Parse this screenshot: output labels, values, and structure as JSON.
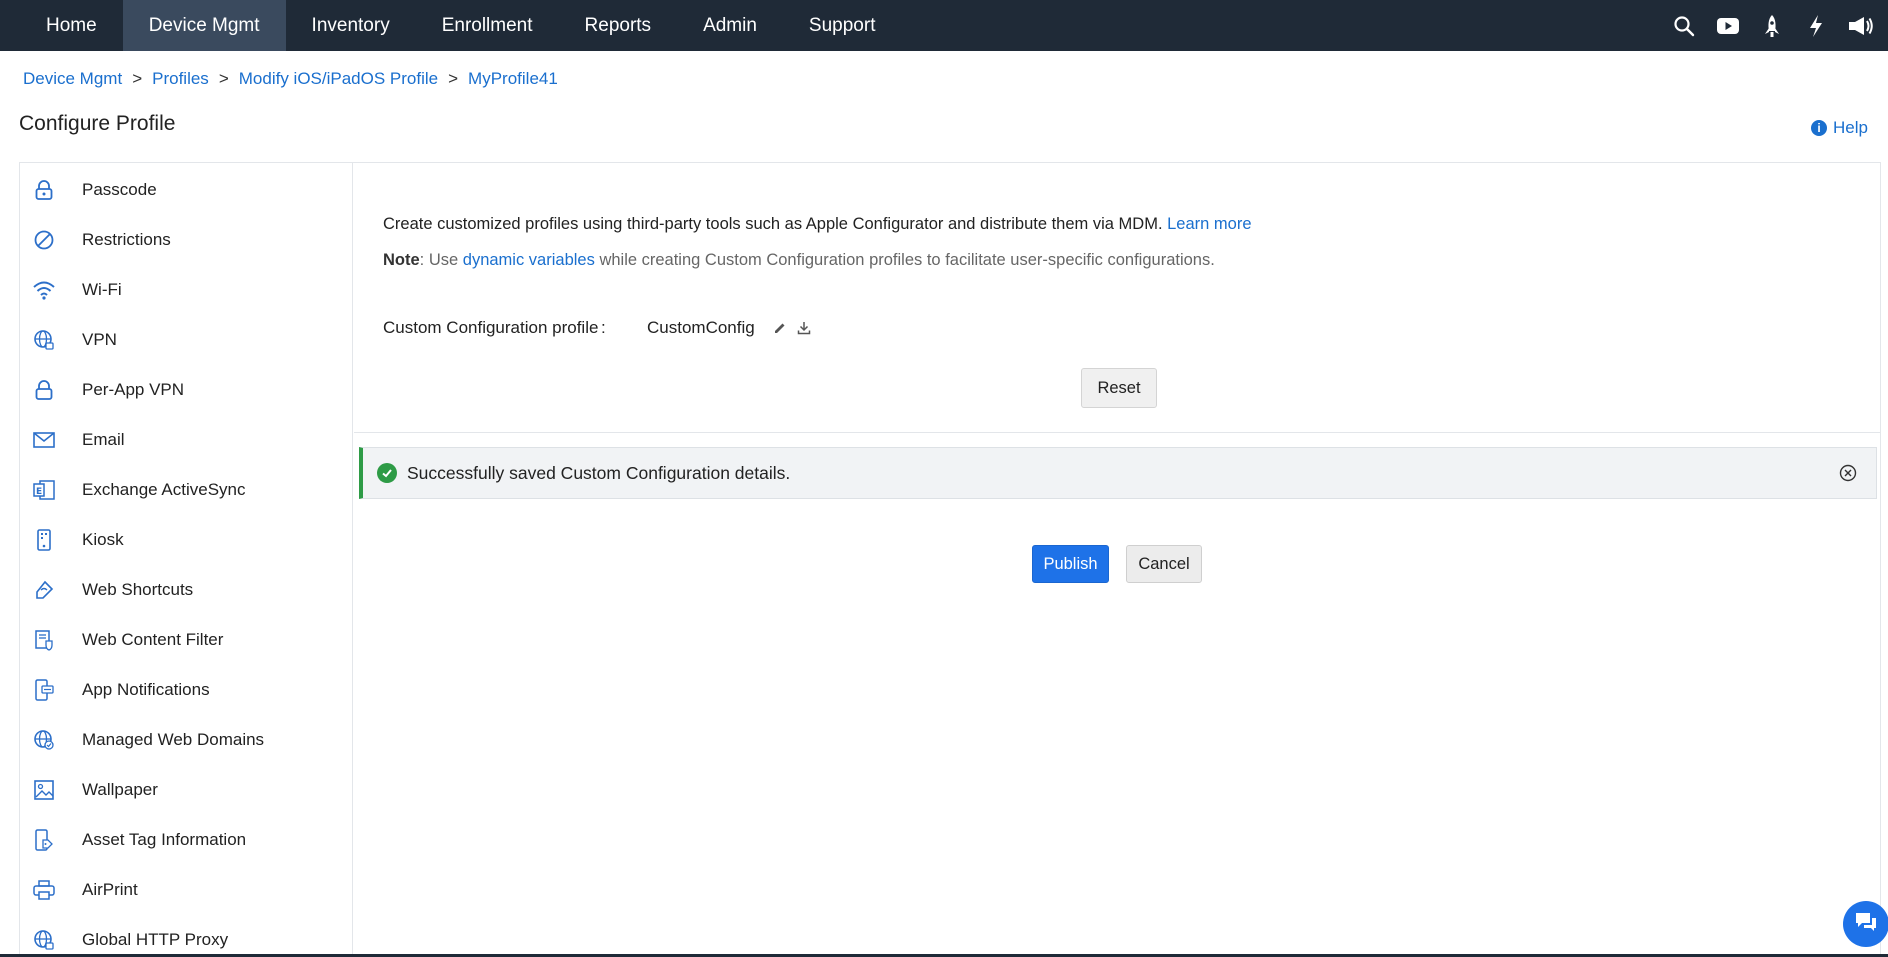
{
  "nav": {
    "items": [
      {
        "label": "Home"
      },
      {
        "label": "Device Mgmt",
        "active": true
      },
      {
        "label": "Inventory"
      },
      {
        "label": "Enrollment"
      },
      {
        "label": "Reports"
      },
      {
        "label": "Admin"
      },
      {
        "label": "Support"
      }
    ],
    "right_icons": [
      "search-icon",
      "youtube-icon",
      "rocket-icon",
      "lightning-icon",
      "announcement-icon"
    ]
  },
  "breadcrumb": {
    "items": [
      "Device Mgmt",
      "Profiles",
      "Modify iOS/iPadOS Profile",
      "MyProfile41"
    ],
    "separator": ">"
  },
  "page": {
    "title": "Configure Profile",
    "help_label": "Help"
  },
  "sidebar": {
    "items": [
      {
        "label": "Passcode",
        "icon": "lock-icon"
      },
      {
        "label": "Restrictions",
        "icon": "restriction-icon"
      },
      {
        "label": "Wi-Fi",
        "icon": "wifi-icon"
      },
      {
        "label": "VPN",
        "icon": "vpn-globe-icon"
      },
      {
        "label": "Per-App VPN",
        "icon": "lock-icon"
      },
      {
        "label": "Email",
        "icon": "email-icon"
      },
      {
        "label": "Exchange ActiveSync",
        "icon": "exchange-icon"
      },
      {
        "label": "Kiosk",
        "icon": "kiosk-icon"
      },
      {
        "label": "Web Shortcuts",
        "icon": "web-shortcut-icon"
      },
      {
        "label": "Web Content Filter",
        "icon": "content-filter-icon"
      },
      {
        "label": "App Notifications",
        "icon": "app-notification-icon"
      },
      {
        "label": "Managed Web Domains",
        "icon": "managed-domain-icon"
      },
      {
        "label": "Wallpaper",
        "icon": "image-icon"
      },
      {
        "label": "Asset Tag Information",
        "icon": "asset-tag-icon"
      },
      {
        "label": "AirPrint",
        "icon": "printer-icon"
      },
      {
        "label": "Global HTTP Proxy",
        "icon": "proxy-globe-icon"
      }
    ]
  },
  "content": {
    "description": "Create customized profiles using third-party tools such as Apple Configurator and distribute them via MDM.",
    "learn_more": "Learn more",
    "note_label": "Note",
    "note_prefix": ": Use",
    "note_link": "dynamic variables",
    "note_suffix": "while creating Custom Configuration profiles to facilitate user-specific configurations.",
    "profile_label": "Custom Configuration profile",
    "profile_colon": ":",
    "profile_value": "CustomConfig",
    "reset_label": "Reset"
  },
  "alert": {
    "message": "Successfully saved Custom Configuration details.",
    "color": "#2e9b46"
  },
  "actions": {
    "publish_label": "Publish",
    "cancel_label": "Cancel"
  },
  "colors": {
    "nav_bg": "#1f2a37",
    "accent": "#1e72e8",
    "link": "#1a6fce"
  }
}
